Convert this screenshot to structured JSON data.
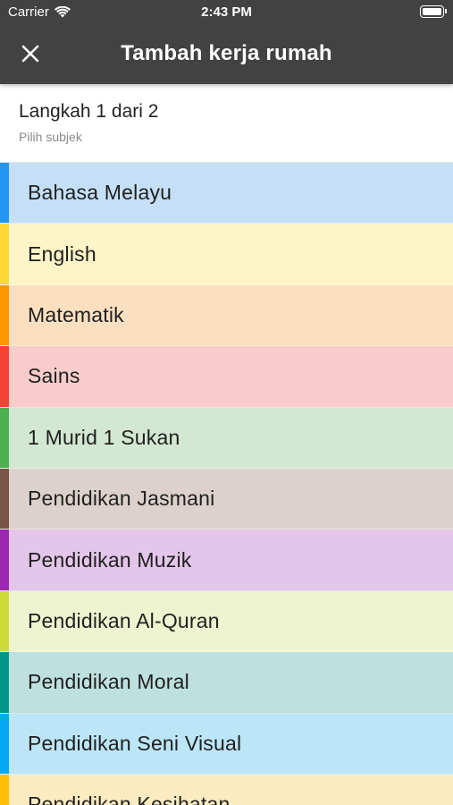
{
  "status_bar": {
    "carrier": "Carrier",
    "time": "2:43 PM"
  },
  "app_bar": {
    "title": "Tambah kerja rumah",
    "close_icon": "close-icon"
  },
  "step": {
    "title": "Langkah 1 dari 2",
    "subtitle": "Pilih subjek"
  },
  "subjects": [
    {
      "label": "Bahasa Melayu",
      "bg": "#c5e0f6",
      "accent": "#2196f3"
    },
    {
      "label": "English",
      "bg": "#fdf5c8",
      "accent": "#fdd835"
    },
    {
      "label": "Matematik",
      "bg": "#fae0c0",
      "accent": "#ff9800"
    },
    {
      "label": "Sains",
      "bg": "#f7cccb",
      "accent": "#f44336"
    },
    {
      "label": "1 Murid 1 Sukan",
      "bg": "#d3e8d3",
      "accent": "#4caf50"
    },
    {
      "label": "Pendidikan Jasmani",
      "bg": "#ddd1cd",
      "accent": "#795548"
    },
    {
      "label": "Pendidikan Muzik",
      "bg": "#e3c6ea",
      "accent": "#9c27b0"
    },
    {
      "label": "Pendidikan Al-Quran",
      "bg": "#eff4d0",
      "accent": "#cddc39"
    },
    {
      "label": "Pendidikan Moral",
      "bg": "#bfe1de",
      "accent": "#009688"
    },
    {
      "label": "Pendidikan Seni Visual",
      "bg": "#bce6f8",
      "accent": "#03a9f4"
    },
    {
      "label": "Pendidikan Kesihatan",
      "bg": "#fdebc0",
      "accent": "#ffc107"
    }
  ]
}
